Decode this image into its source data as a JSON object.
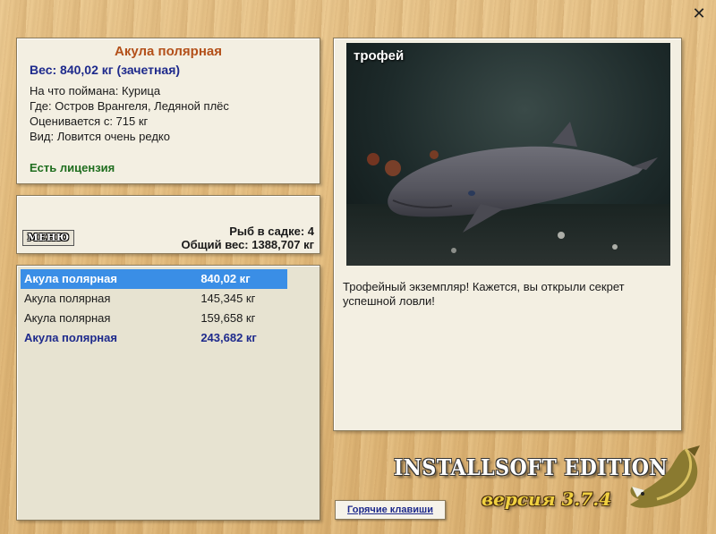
{
  "window": {
    "close_label": "✕"
  },
  "info": {
    "fish_name": "Акула полярная",
    "weight": "Вес: 840,02 кг (зачетная)",
    "bait": "На что поймана: Курица",
    "location": "Где: Остров Врангеля, Ледяной плёс",
    "rated_from": "Оценивается с: 715 кг",
    "rarity": "Вид: Ловится очень редко",
    "license": "Есть лицензия"
  },
  "stats": {
    "menu_label": "МЕНЮ",
    "fish_count": "Рыб в садке: 4",
    "total_weight": "Общий вес: 1388,707 кг"
  },
  "catch_list": [
    {
      "name": "Акула полярная",
      "weight": "840,02 кг",
      "selected": true,
      "trophy": true
    },
    {
      "name": "Акула полярная",
      "weight": "145,345 кг",
      "selected": false,
      "trophy": false
    },
    {
      "name": "Акула полярная",
      "weight": "159,658 кг",
      "selected": false,
      "trophy": false
    },
    {
      "name": "Акула полярная",
      "weight": "243,682 кг",
      "selected": false,
      "trophy": true
    }
  ],
  "photo": {
    "badge": "трофей",
    "description": "Трофейный экземпляр! Кажется, вы открыли секрет успешной ловли!"
  },
  "brand": {
    "edition": "INSTALLSOFT EDITION",
    "version": "версия 3.7.4"
  },
  "hotkeys_label": "Горячие клавиши",
  "colors": {
    "selection": "#3a8ee6",
    "trophy_text": "#1e2a8c",
    "title": "#b3501a",
    "license": "#1f6e1f"
  }
}
